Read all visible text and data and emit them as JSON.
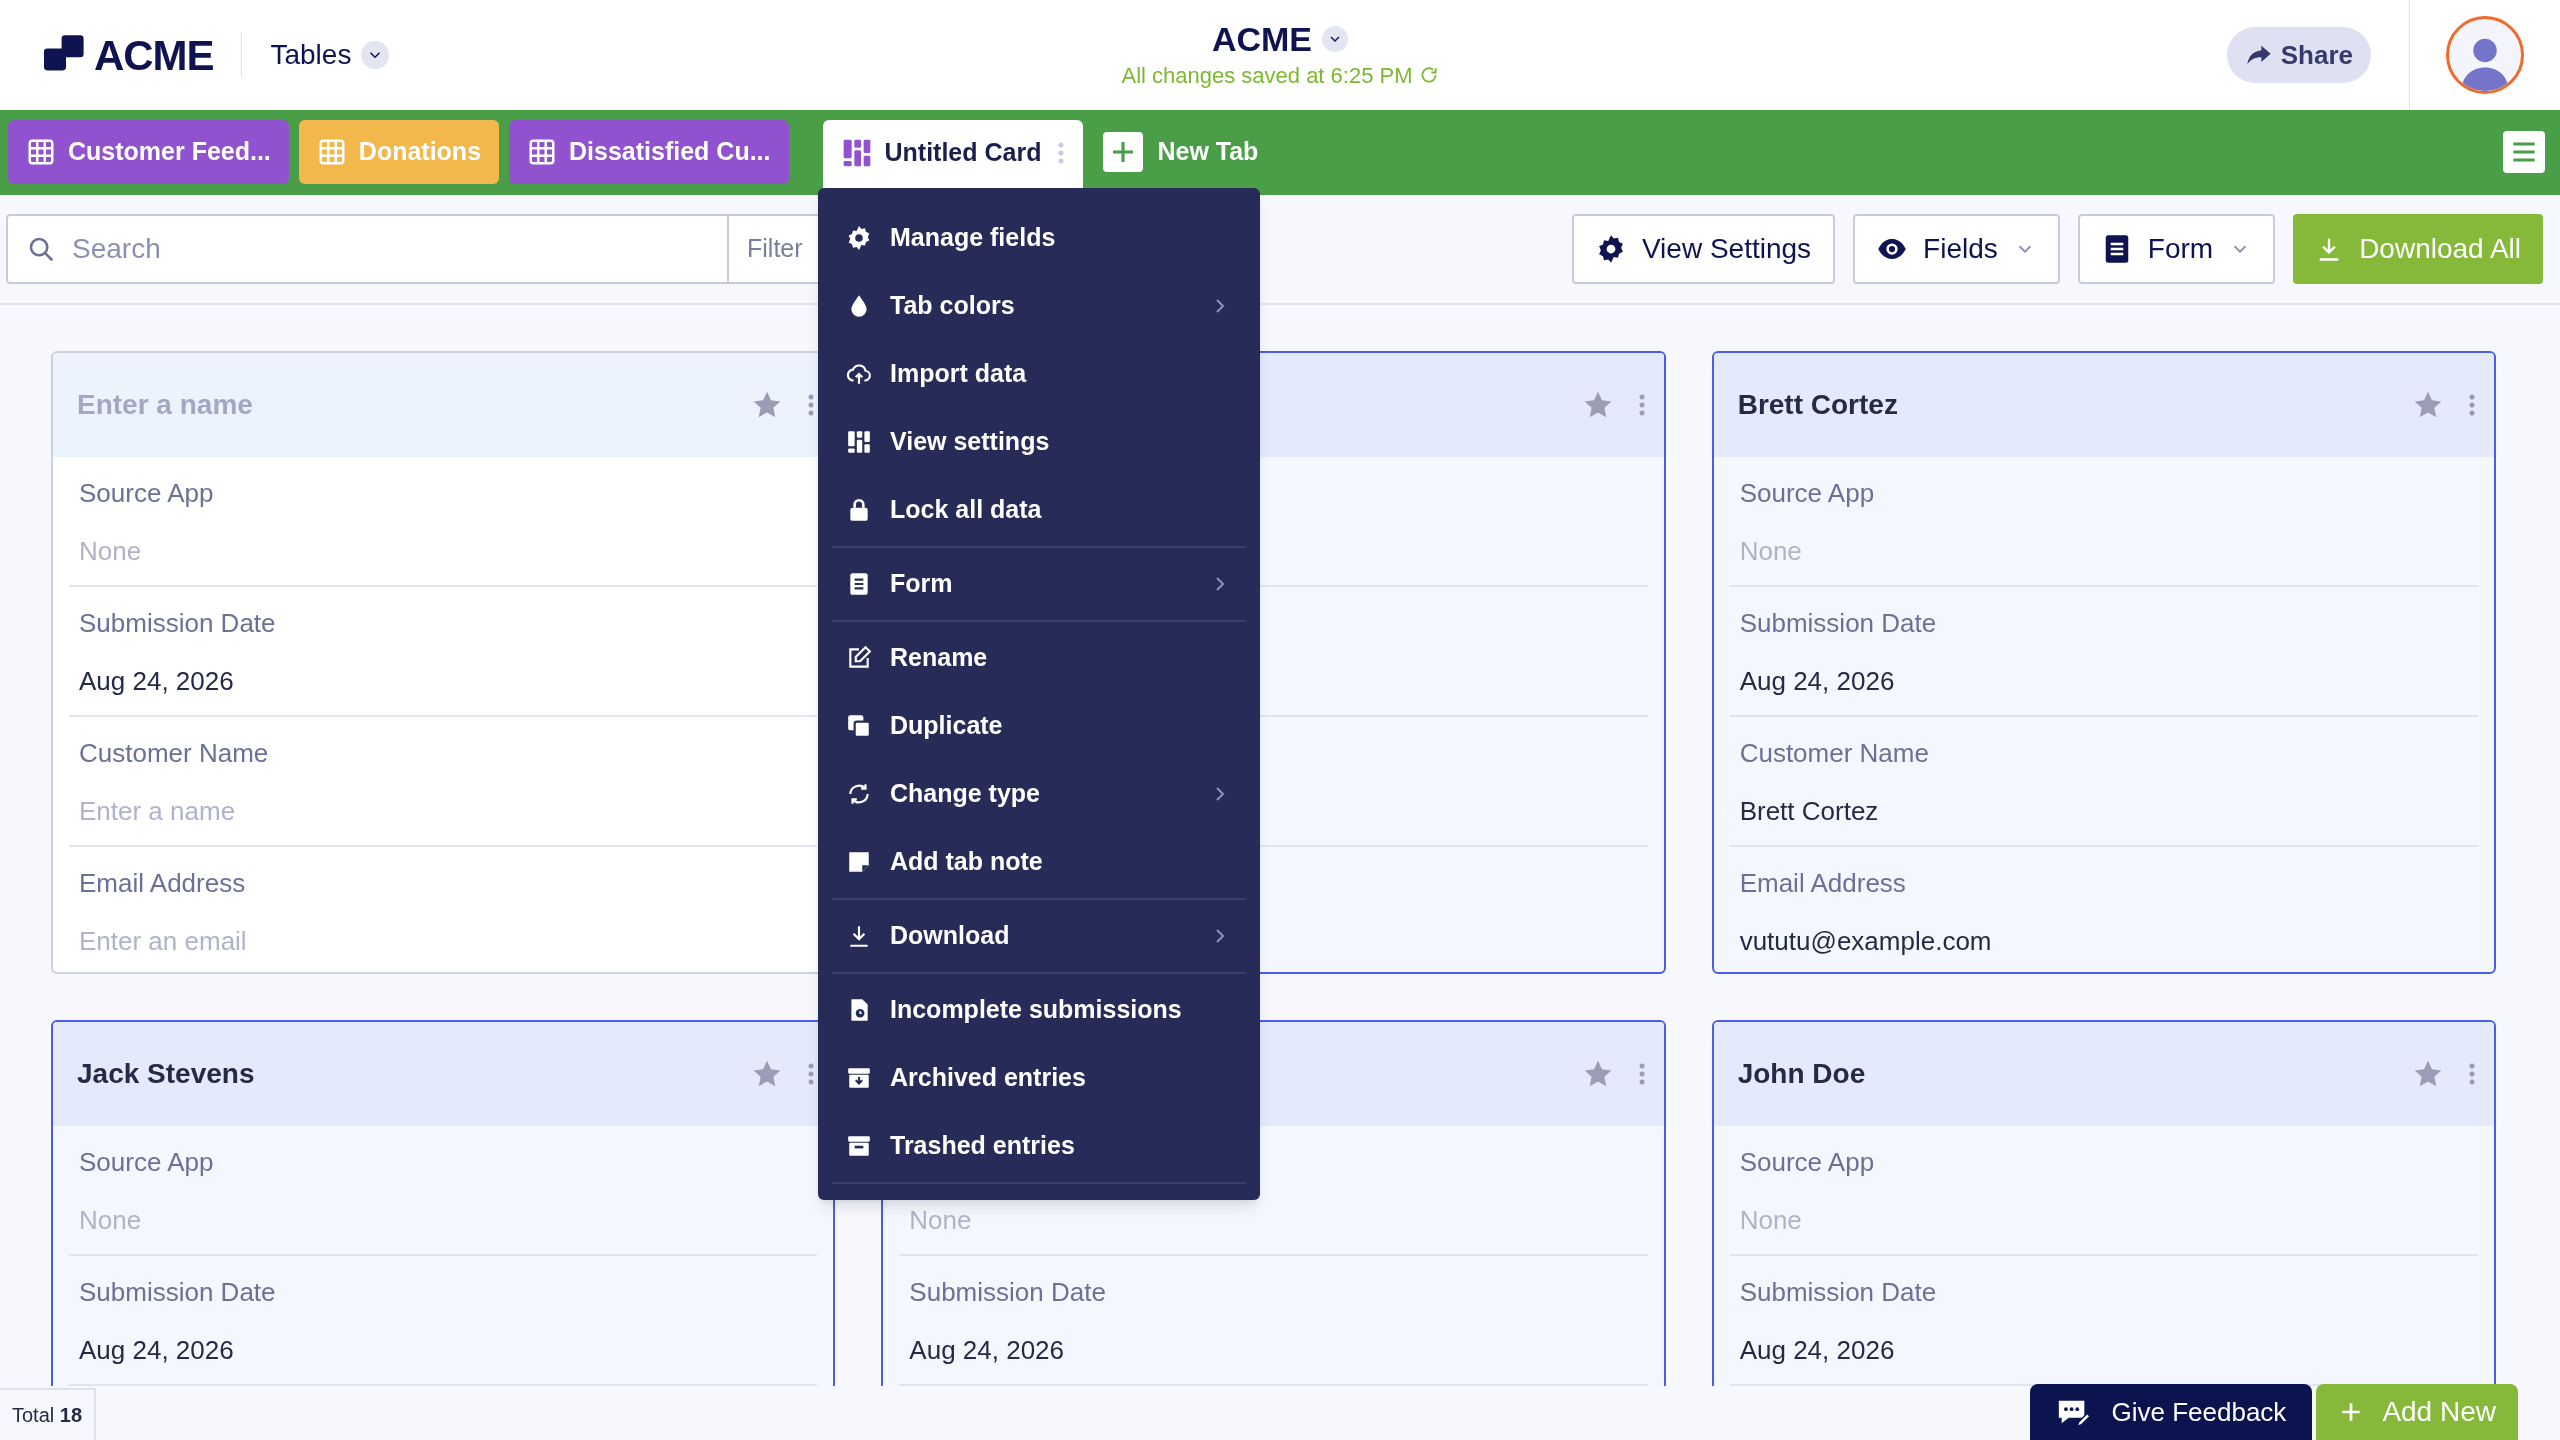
{
  "header": {
    "logo": "ACME",
    "section": "Tables",
    "title": "ACME",
    "save_status": "All changes saved at 6:25 PM",
    "share": "Share"
  },
  "tabs": [
    {
      "label": "Customer Feed...",
      "color": "#9052cf",
      "selected": false
    },
    {
      "label": "Donations",
      "color": "#f2b84b",
      "selected": false
    },
    {
      "label": "Dissatisfied Cu...",
      "color": "#9052cf",
      "selected": false
    },
    {
      "label": "Untitled Card",
      "color": "#ffffff",
      "selected": true
    }
  ],
  "new_tab": "New Tab",
  "toolbar": {
    "search": {
      "placeholder": "Search"
    },
    "filter": "Filter",
    "buttons": [
      {
        "label": "View Settings",
        "dropdown": false
      },
      {
        "label": "Fields",
        "dropdown": true
      },
      {
        "label": "Form",
        "dropdown": true
      }
    ],
    "download": "Download All"
  },
  "menu": [
    [
      {
        "label": "Manage fields",
        "submenu": false
      },
      {
        "label": "Tab colors",
        "submenu": true
      },
      {
        "label": "Import data",
        "submenu": false
      },
      {
        "label": "View settings",
        "submenu": false
      },
      {
        "label": "Lock all data",
        "submenu": false
      }
    ],
    [
      {
        "label": "Form",
        "submenu": true
      }
    ],
    [
      {
        "label": "Rename",
        "submenu": false
      },
      {
        "label": "Duplicate",
        "submenu": false
      },
      {
        "label": "Change type",
        "submenu": true
      },
      {
        "label": "Add tab note",
        "submenu": false
      }
    ],
    [
      {
        "label": "Download",
        "submenu": true
      }
    ],
    [
      {
        "label": "Incomplete submissions",
        "submenu": false
      },
      {
        "label": "Archived entries",
        "submenu": false
      },
      {
        "label": "Trashed entries",
        "submenu": false
      }
    ]
  ],
  "cards": [
    {
      "kind": "new",
      "placeholder": "Enter a name",
      "fields": [
        {
          "label": "Source App",
          "placeholder": "None"
        },
        {
          "label": "Submission Date",
          "value": "Aug 24, 2026"
        },
        {
          "label": "Customer Name",
          "placeholder": "Enter a name"
        },
        {
          "label": "Email Address",
          "placeholder": "Enter an email"
        }
      ]
    },
    {
      "kind": "entry"
    },
    {
      "kind": "entry",
      "title": "Brett Cortez",
      "fields": [
        {
          "label": "Source App",
          "placeholder": "None"
        },
        {
          "label": "Submission Date",
          "value": "Aug 24, 2026"
        },
        {
          "label": "Customer Name",
          "value": "Brett Cortez"
        },
        {
          "label": "Email Address",
          "value": "vututu@example.com"
        }
      ]
    },
    {
      "kind": "entry",
      "title": "Jack Stevens",
      "fields": [
        {
          "label": "Source App",
          "placeholder": "None"
        },
        {
          "label": "Submission Date",
          "value": "Aug 24, 2026"
        }
      ]
    },
    {
      "kind": "entry",
      "fields": [
        {
          "placeholder": "None"
        },
        {
          "label": "Submission Date",
          "value": "Aug 24, 2026"
        }
      ]
    },
    {
      "kind": "entry",
      "title": "John Doe",
      "fields": [
        {
          "label": "Source App",
          "placeholder": "None"
        },
        {
          "label": "Submission Date",
          "value": "Aug 24, 2026"
        }
      ]
    }
  ],
  "footer": {
    "total": "Total **18**",
    "feedback": "Give Feedback",
    "add_new": "Add New"
  }
}
